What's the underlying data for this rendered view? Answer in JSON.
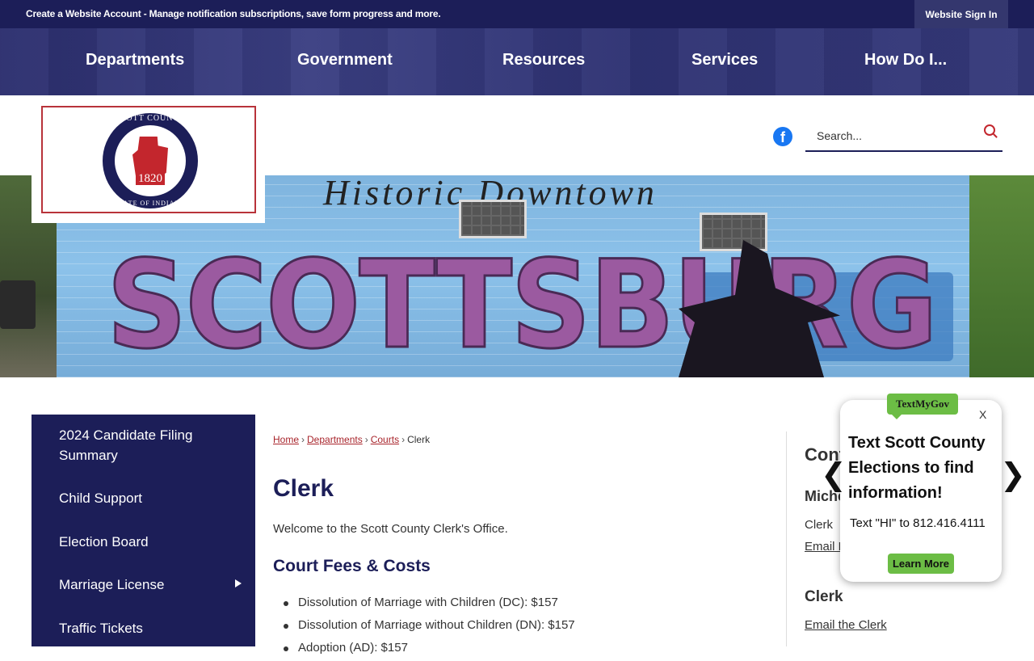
{
  "utility_bar": {
    "message": "Create a Website Account - Manage notification subscriptions, save form progress and more.",
    "sign_in": "Website Sign In"
  },
  "main_nav": [
    "Departments",
    "Government",
    "Resources",
    "Services",
    "How Do I..."
  ],
  "logo": {
    "ring_top": "SCOTT COUNTY",
    "ring_bottom": "STATE OF INDIANA",
    "year": "1820"
  },
  "search": {
    "placeholder": "Search..."
  },
  "banner": {
    "script_text": "Historic Downtown",
    "mural_text": "SCOTTSBURG"
  },
  "side_menu": {
    "items": [
      "2024 Candidate Filing Summary",
      "Child Support",
      "Election Board",
      "Marriage License",
      "Traffic Tickets"
    ]
  },
  "breadcrumb": {
    "links": [
      "Home",
      "Departments",
      "Courts"
    ],
    "current": "Clerk",
    "separator": "›"
  },
  "content": {
    "title": "Clerk",
    "welcome": "Welcome to the Scott County Clerk's Office.",
    "section_heading": "Court Fees & Costs",
    "fees": [
      "Dissolution of Marriage with Children (DC): $157",
      "Dissolution of Marriage without Children (DN): $157",
      "Adoption (AD): $157"
    ]
  },
  "contact": {
    "heading": "Cont",
    "name": "Miche",
    "role": "Clerk",
    "email_link": "Email M",
    "clerk_heading": "Clerk",
    "clerk_email": "Email the Clerk"
  },
  "popup": {
    "badge": "TextMyGov",
    "close": "X",
    "heading": "Text Scott County Elections to find information!",
    "body": "Text \"HI\" to 812.416.4111",
    "button": "Learn More",
    "prev": "❮",
    "next": "❯"
  },
  "colors": {
    "navy": "#1c1e58",
    "accent_red": "#a8242b",
    "tmg_green": "#6cbd45"
  }
}
